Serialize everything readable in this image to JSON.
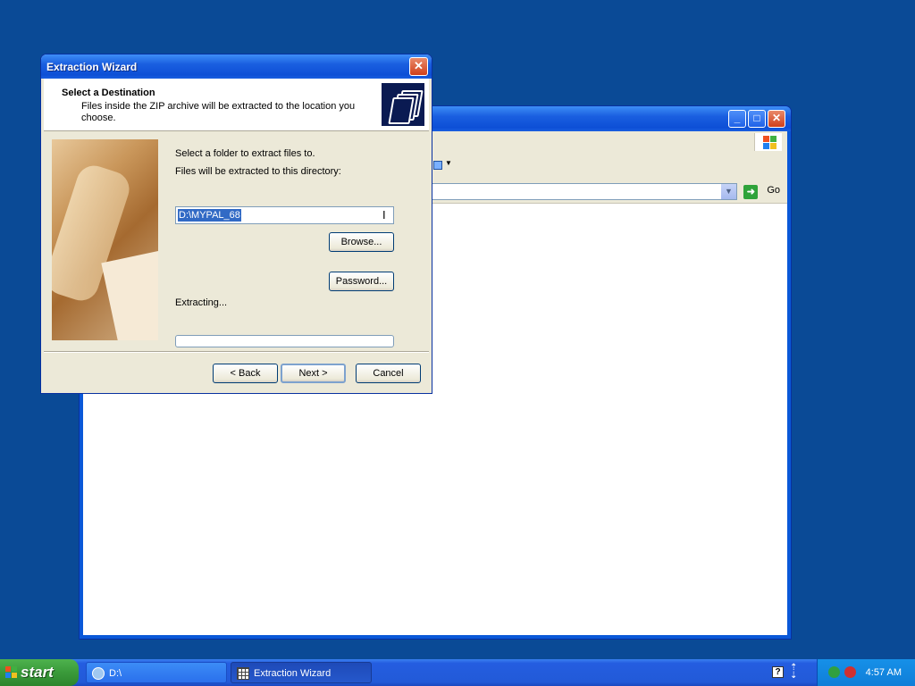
{
  "background_window": {
    "go_label": "Go"
  },
  "wizard": {
    "title": "Extraction Wizard",
    "header_title": "Select a Destination",
    "header_subtitle": "Files inside the ZIP archive will be extracted to the location you choose.",
    "instruction": "Select a folder to extract files to.",
    "dir_label": "Files will be extracted to this directory:",
    "dir_value": "D:\\MYPAL_68",
    "browse_label": "Browse...",
    "password_label": "Password...",
    "progress_label": "Extracting...",
    "progress_value": 0,
    "back_label": "< Back",
    "next_label": "Next >",
    "cancel_label": "Cancel"
  },
  "taskbar": {
    "start_label": "start",
    "items": [
      {
        "label": "D:\\",
        "icon": "cd-drive-icon",
        "active": false
      },
      {
        "label": "Extraction Wizard",
        "icon": "wizard-app-icon",
        "active": true
      }
    ],
    "clock": "4:57 AM"
  },
  "colors": {
    "desktop": "#0a4a96",
    "titlebar": "#0d4fd6",
    "start_button": "#3a9a3a",
    "selection": "#316ac5"
  }
}
